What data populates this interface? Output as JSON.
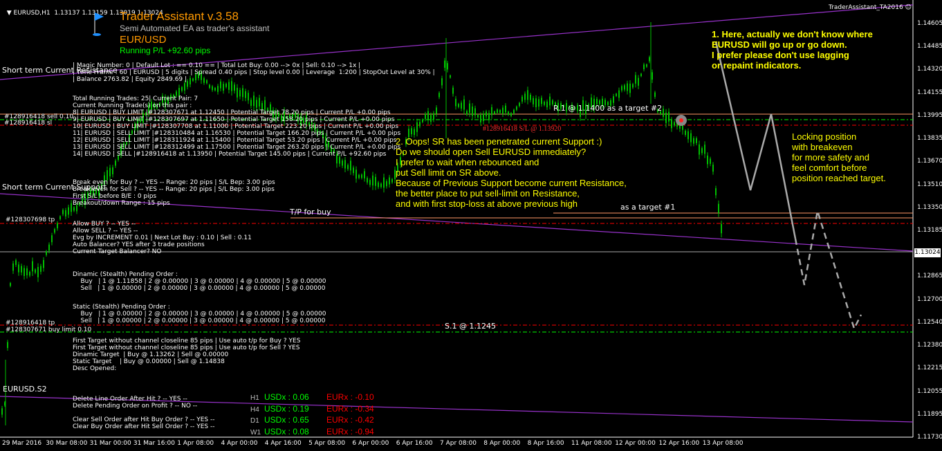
{
  "header": {
    "symbol_line": "EURUSD,H1  1.13137 1.13159 1.13019 1.13024",
    "ea_title": "Trader Assistant v.3.58",
    "ea_subtitle": "Semi Automated EA as trader's assistant",
    "pair": "EUR/USD",
    "running_pl": "Running P/L +92.60 pips",
    "top_right_tag": "TraderAssistant_TA2016",
    "flag_icon": "blue-flag-icon"
  },
  "price_axis": {
    "labels": [
      "1.14605",
      "1.14485",
      "1.14320",
      "1.14155",
      "1.13995",
      "1.13835",
      "1.13670",
      "1.13510",
      "1.13350",
      "1.13185",
      "1.13024",
      "1.12865",
      "1.12700",
      "1.12540",
      "1.12380",
      "1.12215",
      "1.12055",
      "1.11895",
      "1.11730"
    ],
    "current_price": "1.13024"
  },
  "time_axis": {
    "labels": [
      "29 Mar 2016",
      "30 Mar 08:00",
      "31 Mar 00:00",
      "31 Mar 16:00",
      "1 Apr 08:00",
      "4 Apr 00:00",
      "4 Apr 16:00",
      "5 Apr 08:00",
      "6 Apr 00:00",
      "6 Apr 16:00",
      "7 Apr 08:00",
      "8 Apr 00:00",
      "8 Apr 16:00",
      "11 Apr 08:00",
      "12 Apr 00:00",
      "12 Apr 16:00",
      "13 Apr 08:00"
    ]
  },
  "chart_labels": {
    "short_term_top": "Short term Current Resistance",
    "short_term_mid": "Short term Current Support",
    "sell_tag": "#128916418 sell 0.10",
    "sl_tag": "#128916418 sl",
    "tp_tag_mid": "#128307698 tp",
    "tp_tag_low": "#128916418 tp",
    "buy_limit_tag": "#128307671 buy limit 0.10",
    "sl_center": "#128916418 S/L @ 1.13920",
    "r1_target": "R.1 @ 1.1400 as a target #2",
    "target1": "as a target #1",
    "tp_for_buy": "T/P for buy",
    "s1": "S.1 @ 1.1245",
    "eurusd_s2": "EURUSD.S2"
  },
  "info_panel": {
    "lines1": [
      "| Magic Number: 0 | Default Lot : == 0.10 == | Total Lot Buy: 0.00 --> 0x | Sell: 0.10 --> 1x |",
      "| Time Frame : 60 | EURUSD | 5 digits | Spread 0.40 pips | Stop level 0.00 | Leverage  1:200 | StopOut Level at 30% |",
      "| Balance 2763.82 | Equity 2849.69 |"
    ],
    "lines2": [
      "Total Running Trades: 25| Current Pair: 7",
      "Current Running Trade(s) on this pair :",
      "8| EURUSD | BUY LIMIT |#128307671 at 1.12450 | Potential Target 78.20 pips | Current P/L +0.00 pips",
      "9| EURUSD | BUY LIMIT |#128307697 at 1.11650 | Potential Target 158.20 pips | Current P/L +0.00 pips",
      "10| EURUSD | BUY LIMIT |#128307708 at 1.11000 | Potential Target 223.20 pips | Current P/L +0.00 pips",
      "11| EURUSD | SELL LIMIT |#128310484 at 1.16530 | Potential Target 166.20 pips | Current P/L +0.00 pips",
      "12| EURUSD | SELL LIMIT |#128311924 at 1.15400 | Potential Target 53.20 pips | Current P/L +0.00 pips",
      "13| EURUSD | SELL LIMIT |#128312499 at 1.17500 | Potential Target 263.20 pips | Current P/L +0.00 pips",
      "14| EURUSD | SELL |#128916418 at 1.13950 | Potential Target 145.00 pips | Current P/L +92.60 pips"
    ],
    "lines3": [
      "Break even for Buy ? -- YES -- Range: 20 pips | S/L Bep: 3.00 pips",
      "Break even for Sell ? -- YES -- Range: 20 pips | S/L Bep: 3.00 pips",
      "First S/L before B/E : 0 pips",
      "Breakout/down Range : 15 pips"
    ],
    "lines4": [
      "Allow BUY ? -- YES --",
      "Allow SELL ? -- YES --",
      "Evg by INCREMENT 0.01 | Next Lot Buy : 0.10 | Sell : 0.11",
      "Auto Balancer? YES after 3 trade positions",
      "Current Target Balancer? NO"
    ],
    "lines5": [
      "Dinamic (Stealth) Pending Order :",
      "    Buy   | 1 @ 1.11858 | 2 @ 0.00000 | 3 @ 0.00000 | 4 @ 0.00000 | 5 @ 0.00000",
      "    Sell   | 1 @ 0.00000 | 2 @ 0.00000 | 3 @ 0.00000 | 4 @ 0.00000 | 5 @ 0.00000"
    ],
    "lines6": [
      "Static (Stealth) Pending Order :",
      "    Buy   | 1 @ 0.00000 | 2 @ 0.00000 | 3 @ 0.00000 | 4 @ 0.00000 | 5 @ 0.00000",
      "    Sell   | 1 @ 0.00000 | 2 @ 0.00000 | 3 @ 0.00000 | 4 @ 0.00000 | 5 @ 0.00000"
    ],
    "lines7": [
      "First Target without channel closeline 85 pips | Use auto t/p for Buy ? YES",
      "First Target without channel closeline 85 pips | Use auto t/p for Sell ? YES",
      "Dinamic Target  | Buy @ 1.13262 | Sell @ 0.00000",
      "Static Target    | Buy @ 0.00000 | Sell @ 1.14838",
      "Desc Opened:"
    ],
    "lines8": [
      "Delete Line Order After Hit ? -- YES --",
      "Delete Pending Order on Profit ? -- NO --",
      "",
      "Clear Sell Order after Hit Buy Order ? -- YES --",
      "Clear Buy Order after Hit Sell Order ? -- YES --"
    ]
  },
  "strength_table": {
    "rows": [
      {
        "tf": "H1",
        "usd": "USDx : 0.06",
        "eur": "EURx : -0.10"
      },
      {
        "tf": "H4",
        "usd": "USDx : 0.19",
        "eur": "EURx : -0.34"
      },
      {
        "tf": "D1",
        "usd": "USDx : 0.65",
        "eur": "EURx : -0.42"
      },
      {
        "tf": "W1",
        "usd": "USDx : 0.08",
        "eur": "EURx : -0.94"
      }
    ],
    "colors": {
      "usd": "#00ff00",
      "eur": "#ff0000",
      "tf": "#c0c0c0"
    }
  },
  "annotations": {
    "note1": [
      "1. Here, actually we don't know where",
      "EURUSD will go up or go down.",
      "I prefer please don't use lagging",
      "or repaint indicators."
    ],
    "note2": [
      "2. Oops! SR has been penetrated current Support :)",
      "Do we should open Sell EURUSD immediately?",
      "I prefer to wait when rebounced and",
      "put Sell limit on SR above.",
      "Because of Previous Support become current Resistance,",
      "the better place to put sell-limit on Resistance,",
      "and with first stop-loss at above previous high"
    ],
    "note3": [
      "Locking position",
      "with breakeven",
      "for more safety and",
      "feel comfort before",
      "position reached target."
    ]
  },
  "colors": {
    "background": "#000000",
    "candles": "#00c000",
    "channel": "#9932cc",
    "annotation": "#ffff00",
    "title": "#ff9900",
    "dash_red": "#ff0000",
    "dash_green": "#00ff00"
  }
}
